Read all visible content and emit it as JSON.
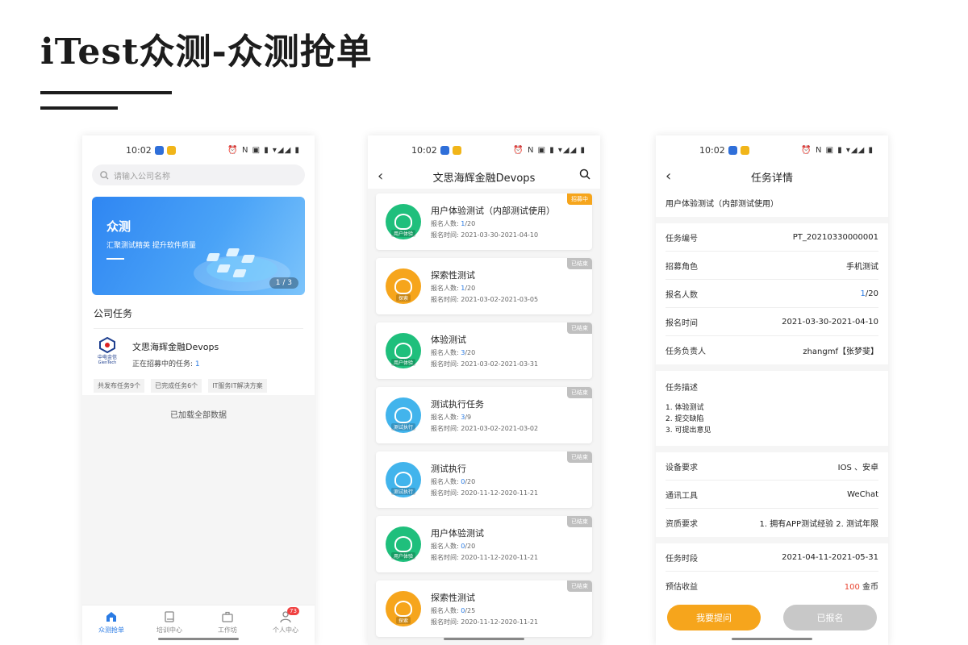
{
  "page": {
    "title": "iTest众测-众测抢单"
  },
  "status": {
    "time": "10:02",
    "icons": "⏰ N ▣ ▮ ▾◢◢ ▮"
  },
  "phone1": {
    "search_placeholder": "请输入公司名称",
    "banner": {
      "title": "众测",
      "subtitle": "汇聚测试精英  提升软件质量",
      "page": "1 / 3"
    },
    "section_title": "公司任务",
    "company": {
      "name": "文思海辉金融Devops",
      "open_label": "正在招募中的任务: ",
      "open_count": "1",
      "logo_text": "中电金信",
      "logo_sub": "GienTech",
      "tags": [
        "共发布任务9个",
        "已完成任务6个",
        "IT服务IT解决方案"
      ]
    },
    "loaded_all": "已加载全部数据",
    "tabs": [
      {
        "label": "众测抢单",
        "icon": "home-icon"
      },
      {
        "label": "培训中心",
        "icon": "book-icon"
      },
      {
        "label": "工作坊",
        "icon": "briefcase-icon"
      },
      {
        "label": "个人中心",
        "icon": "person-icon",
        "badge": "73"
      }
    ]
  },
  "phone2": {
    "nav_title": "文思海辉金融Devops",
    "tasks": [
      {
        "title": "用户体验测试（内部测试使用）",
        "count_label": "报名人数: ",
        "count_current": "1",
        "count_total": "/20",
        "time": "报名时间: 2021-03-30-2021-04-10",
        "status": "招募中",
        "icon_caption": "用户体验",
        "icon_color": "#1fbf7c",
        "status_color": "#f6a51c"
      },
      {
        "title": "探索性测试",
        "count_label": "报名人数: ",
        "count_current": "1",
        "count_total": "/20",
        "time": "报名时间: 2021-03-02-2021-03-05",
        "status": "已结束",
        "icon_caption": "探索",
        "icon_color": "#f6a51c",
        "status_color": "#c0c0c0"
      },
      {
        "title": "体验测试",
        "count_label": "报名人数: ",
        "count_current": "3",
        "count_total": "/20",
        "time": "报名时间: 2021-03-02-2021-03-31",
        "status": "已结束",
        "icon_caption": "用户体验",
        "icon_color": "#1fbf7c",
        "status_color": "#c0c0c0"
      },
      {
        "title": "测试执行任务",
        "count_label": "报名人数: ",
        "count_current": "3",
        "count_total": "/9",
        "time": "报名时间: 2021-03-02-2021-03-02",
        "status": "已结束",
        "icon_caption": "测试执行",
        "icon_color": "#42b4ec",
        "status_color": "#c0c0c0"
      },
      {
        "title": "测试执行",
        "count_label": "报名人数: ",
        "count_current": "0",
        "count_total": "/20",
        "time": "报名时间: 2020-11-12-2020-11-21",
        "status": "已结束",
        "icon_caption": "测试执行",
        "icon_color": "#42b4ec",
        "status_color": "#c0c0c0"
      },
      {
        "title": "用户体验测试",
        "count_label": "报名人数: ",
        "count_current": "0",
        "count_total": "/20",
        "time": "报名时间: 2020-11-12-2020-11-21",
        "status": "已结束",
        "icon_caption": "用户体验",
        "icon_color": "#1fbf7c",
        "status_color": "#c0c0c0"
      },
      {
        "title": "探索性测试",
        "count_label": "报名人数: ",
        "count_current": "0",
        "count_total": "/25",
        "time": "报名时间: 2020-11-12-2020-11-21",
        "status": "已结束",
        "icon_caption": "探索",
        "icon_color": "#f6a51c",
        "status_color": "#c0c0c0"
      }
    ]
  },
  "phone3": {
    "nav_title": "任务详情",
    "task_title": "用户体验测试（内部测试使用）",
    "info_rows": [
      {
        "label": "任务编号",
        "value": "PT_20210330000001"
      },
      {
        "label": "招募角色",
        "value": "手机测试"
      },
      {
        "label": "报名人数",
        "value_num": "1",
        "value": "/20"
      },
      {
        "label": "报名时间",
        "value": "2021-03-30-2021-04-10"
      },
      {
        "label": "任务负责人",
        "value": "zhangmf【张梦斐】"
      }
    ],
    "desc_label": "任务描述",
    "desc_lines": [
      "1. 体验测试",
      "2. 提交缺陷",
      "3. 可提出意见"
    ],
    "req_rows": [
      {
        "label": "设备要求",
        "value": "IOS 、安卓"
      },
      {
        "label": "通讯工具",
        "value": "WeChat"
      },
      {
        "label": "资质要求",
        "value": "1. 拥有APP测试经验 2. 测试年限"
      }
    ],
    "period_rows": [
      {
        "label": "任务时段",
        "value": "2021-04-11-2021-05-31"
      },
      {
        "label": "预估收益",
        "value_red": "100",
        "value": " 金币"
      }
    ],
    "btn_ask": "我要提问",
    "btn_signed": "已报名"
  }
}
